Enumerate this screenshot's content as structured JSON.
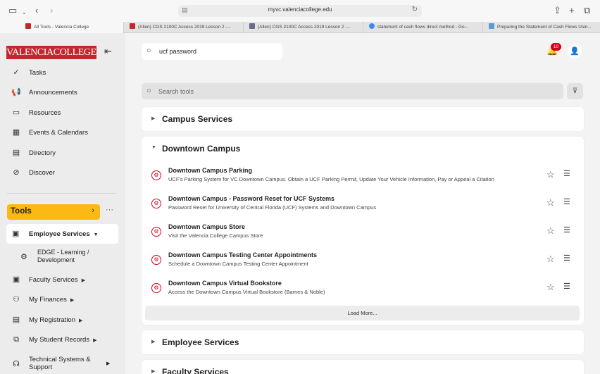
{
  "browser": {
    "url": "myvc.valenciacollege.edu",
    "tabs": [
      {
        "label": "All Tools - Valencia College",
        "favicon_color": "#c1272d"
      },
      {
        "label": "(Allen) CGS 2100C Access 2019 Lesson 2 -...",
        "favicon_color": "#c1272d"
      },
      {
        "label": "(Allen) CGS 2100C Access 2019 Lesson 2 -...",
        "favicon_color": "#6b6b8a"
      },
      {
        "label": "statement of cash flows direct method - Go...",
        "favicon_color": "#4285f4"
      },
      {
        "label": "Preparing the Statement of Cash Flows Usin...",
        "favicon_color": "#5b9bd5"
      }
    ]
  },
  "sidebar": {
    "logo": "VALENCIACOLLEGE",
    "items": [
      {
        "label": "Tasks",
        "icon": "check-circle-icon"
      },
      {
        "label": "Announcements",
        "icon": "megaphone-icon"
      },
      {
        "label": "Resources",
        "icon": "folder-icon"
      },
      {
        "label": "Events & Calendars",
        "icon": "calendar-icon"
      },
      {
        "label": "Directory",
        "icon": "address-book-icon"
      },
      {
        "label": "Discover",
        "icon": "compass-icon"
      }
    ],
    "tools_label": "Tools",
    "employee_services": "Employee Services",
    "edge": "EDGE - Learning / Development",
    "sub_items": [
      {
        "label": "Faculty Services",
        "icon": "id-badge-icon"
      },
      {
        "label": "My Finances",
        "icon": "people-money-icon"
      },
      {
        "label": "My Registration",
        "icon": "register-icon"
      },
      {
        "label": "My Student Records",
        "icon": "records-icon"
      },
      {
        "label": "Technical Systems & Support",
        "icon": "headset-icon"
      }
    ]
  },
  "header": {
    "search_value": "ucf password",
    "notification_count": "10"
  },
  "tools_search": {
    "placeholder": "Search tools"
  },
  "sections": {
    "campus_services": "Campus Services",
    "downtown_campus": "Downtown Campus",
    "employee_services": "Employee Services",
    "faculty_services": "Faculty Services"
  },
  "downtown_tools": [
    {
      "name": "Downtown Campus Parking",
      "desc": "UCF's Parking System for VC Downtown Campus. Obtain a UCF Parking Permit, Update Your Vehicle Information, Pay or Appeal a Citation"
    },
    {
      "name": "Downtown Campus - Password Reset for UCF Systems",
      "desc": "Password Reset for University of Central Florida (UCF) Systems and Downtown Campus"
    },
    {
      "name": "Downtown Campus Store",
      "desc": "Visit the Valencia College Campus Store"
    },
    {
      "name": "Downtown Campus Testing Center Appointments",
      "desc": "Schedule a Downtown Campus Testing Center Appointment"
    },
    {
      "name": "Downtown Campus Virtual Bookstore",
      "desc": "Access the Downtown Campus Virtual Bookstore (Barnes & Noble)"
    }
  ],
  "load_more": "Load More...",
  "colors": {
    "brand_red": "#c1272d",
    "tools_yellow": "#fdb913",
    "badge_red": "#d0021b"
  }
}
